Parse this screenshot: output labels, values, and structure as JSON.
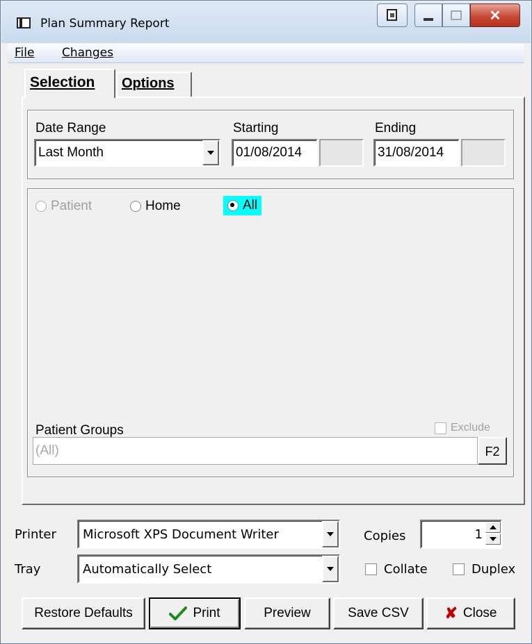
{
  "window": {
    "title": "Plan Summary Report"
  },
  "menu": {
    "file": "File",
    "changes": "Changes"
  },
  "tabs": {
    "selection": "Selection",
    "options": "Options"
  },
  "date_range": {
    "label": "Date Range",
    "value": "Last Month",
    "starting_label": "Starting",
    "starting_value": "01/08/2014",
    "ending_label": "Ending",
    "ending_value": "31/08/2014"
  },
  "scope": {
    "patient": "Patient",
    "home": "Home",
    "all": "All",
    "selected": "all",
    "selected_highlight": "#00ffff"
  },
  "patient_groups": {
    "label": "Patient Groups",
    "exclude_label": "Exclude",
    "value": "(All)",
    "lookup_label": "F2"
  },
  "printer": {
    "printer_label": "Printer",
    "printer_value": "Microsoft XPS Document Writer",
    "tray_label": "Tray",
    "tray_value": "Automatically Select",
    "copies_label": "Copies",
    "copies_value": "1",
    "collate_label": "Collate",
    "duplex_label": "Duplex"
  },
  "buttons": {
    "restore_defaults": "Restore Defaults",
    "print": "Print",
    "preview": "Preview",
    "save_csv": "Save CSV",
    "close": "Close"
  },
  "colors": {
    "titlebar": "#c9daee",
    "close_button": "#c74a36",
    "checkmark": "#1e8a1e",
    "close_x": "#c00000"
  }
}
